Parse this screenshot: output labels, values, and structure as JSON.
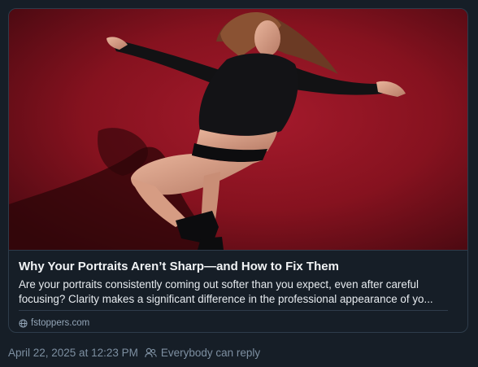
{
  "card": {
    "image": {
      "alt": ""
    },
    "title": "Why Your Portraits Aren’t Sharp—and How to Fix Them",
    "description_line1": "Are your portraits consistently coming out softer than you expect, even after careful",
    "description_line2": "focusing? Clarity makes a significant difference in the professional appearance of yo...",
    "source": "fstoppers.com",
    "source_icon": "globe-icon"
  },
  "post_meta": {
    "timestamp": "April 22, 2025 at 12:23 PM",
    "reply_icon": "people-icon",
    "reply_setting": "Everybody can reply"
  },
  "colors": {
    "background": "#161e27",
    "border": "#2e3c4b",
    "backdrop_red": "#8b1225",
    "muted_text": "#7d8fa1"
  }
}
